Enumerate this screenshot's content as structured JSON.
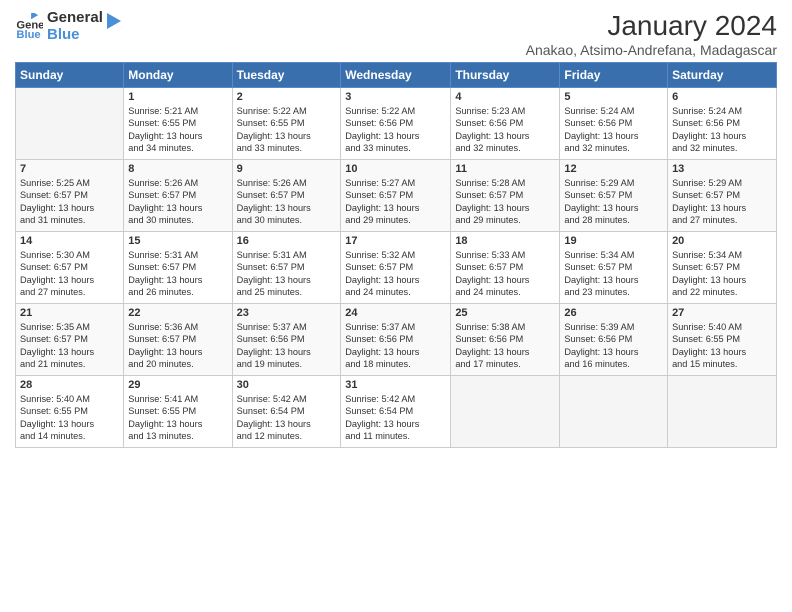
{
  "logo": {
    "text_general": "General",
    "text_blue": "Blue"
  },
  "header": {
    "month": "January 2024",
    "location": "Anakao, Atsimo-Andrefana, Madagascar"
  },
  "columns": [
    "Sunday",
    "Monday",
    "Tuesday",
    "Wednesday",
    "Thursday",
    "Friday",
    "Saturday"
  ],
  "weeks": [
    [
      {
        "day": "",
        "content": ""
      },
      {
        "day": "1",
        "content": "Sunrise: 5:21 AM\nSunset: 6:55 PM\nDaylight: 13 hours\nand 34 minutes."
      },
      {
        "day": "2",
        "content": "Sunrise: 5:22 AM\nSunset: 6:55 PM\nDaylight: 13 hours\nand 33 minutes."
      },
      {
        "day": "3",
        "content": "Sunrise: 5:22 AM\nSunset: 6:56 PM\nDaylight: 13 hours\nand 33 minutes."
      },
      {
        "day": "4",
        "content": "Sunrise: 5:23 AM\nSunset: 6:56 PM\nDaylight: 13 hours\nand 32 minutes."
      },
      {
        "day": "5",
        "content": "Sunrise: 5:24 AM\nSunset: 6:56 PM\nDaylight: 13 hours\nand 32 minutes."
      },
      {
        "day": "6",
        "content": "Sunrise: 5:24 AM\nSunset: 6:56 PM\nDaylight: 13 hours\nand 32 minutes."
      }
    ],
    [
      {
        "day": "7",
        "content": "Sunrise: 5:25 AM\nSunset: 6:57 PM\nDaylight: 13 hours\nand 31 minutes."
      },
      {
        "day": "8",
        "content": "Sunrise: 5:26 AM\nSunset: 6:57 PM\nDaylight: 13 hours\nand 30 minutes."
      },
      {
        "day": "9",
        "content": "Sunrise: 5:26 AM\nSunset: 6:57 PM\nDaylight: 13 hours\nand 30 minutes."
      },
      {
        "day": "10",
        "content": "Sunrise: 5:27 AM\nSunset: 6:57 PM\nDaylight: 13 hours\nand 29 minutes."
      },
      {
        "day": "11",
        "content": "Sunrise: 5:28 AM\nSunset: 6:57 PM\nDaylight: 13 hours\nand 29 minutes."
      },
      {
        "day": "12",
        "content": "Sunrise: 5:29 AM\nSunset: 6:57 PM\nDaylight: 13 hours\nand 28 minutes."
      },
      {
        "day": "13",
        "content": "Sunrise: 5:29 AM\nSunset: 6:57 PM\nDaylight: 13 hours\nand 27 minutes."
      }
    ],
    [
      {
        "day": "14",
        "content": "Sunrise: 5:30 AM\nSunset: 6:57 PM\nDaylight: 13 hours\nand 27 minutes."
      },
      {
        "day": "15",
        "content": "Sunrise: 5:31 AM\nSunset: 6:57 PM\nDaylight: 13 hours\nand 26 minutes."
      },
      {
        "day": "16",
        "content": "Sunrise: 5:31 AM\nSunset: 6:57 PM\nDaylight: 13 hours\nand 25 minutes."
      },
      {
        "day": "17",
        "content": "Sunrise: 5:32 AM\nSunset: 6:57 PM\nDaylight: 13 hours\nand 24 minutes."
      },
      {
        "day": "18",
        "content": "Sunrise: 5:33 AM\nSunset: 6:57 PM\nDaylight: 13 hours\nand 24 minutes."
      },
      {
        "day": "19",
        "content": "Sunrise: 5:34 AM\nSunset: 6:57 PM\nDaylight: 13 hours\nand 23 minutes."
      },
      {
        "day": "20",
        "content": "Sunrise: 5:34 AM\nSunset: 6:57 PM\nDaylight: 13 hours\nand 22 minutes."
      }
    ],
    [
      {
        "day": "21",
        "content": "Sunrise: 5:35 AM\nSunset: 6:57 PM\nDaylight: 13 hours\nand 21 minutes."
      },
      {
        "day": "22",
        "content": "Sunrise: 5:36 AM\nSunset: 6:57 PM\nDaylight: 13 hours\nand 20 minutes."
      },
      {
        "day": "23",
        "content": "Sunrise: 5:37 AM\nSunset: 6:56 PM\nDaylight: 13 hours\nand 19 minutes."
      },
      {
        "day": "24",
        "content": "Sunrise: 5:37 AM\nSunset: 6:56 PM\nDaylight: 13 hours\nand 18 minutes."
      },
      {
        "day": "25",
        "content": "Sunrise: 5:38 AM\nSunset: 6:56 PM\nDaylight: 13 hours\nand 17 minutes."
      },
      {
        "day": "26",
        "content": "Sunrise: 5:39 AM\nSunset: 6:56 PM\nDaylight: 13 hours\nand 16 minutes."
      },
      {
        "day": "27",
        "content": "Sunrise: 5:40 AM\nSunset: 6:55 PM\nDaylight: 13 hours\nand 15 minutes."
      }
    ],
    [
      {
        "day": "28",
        "content": "Sunrise: 5:40 AM\nSunset: 6:55 PM\nDaylight: 13 hours\nand 14 minutes."
      },
      {
        "day": "29",
        "content": "Sunrise: 5:41 AM\nSunset: 6:55 PM\nDaylight: 13 hours\nand 13 minutes."
      },
      {
        "day": "30",
        "content": "Sunrise: 5:42 AM\nSunset: 6:54 PM\nDaylight: 13 hours\nand 12 minutes."
      },
      {
        "day": "31",
        "content": "Sunrise: 5:42 AM\nSunset: 6:54 PM\nDaylight: 13 hours\nand 11 minutes."
      },
      {
        "day": "",
        "content": ""
      },
      {
        "day": "",
        "content": ""
      },
      {
        "day": "",
        "content": ""
      }
    ]
  ]
}
